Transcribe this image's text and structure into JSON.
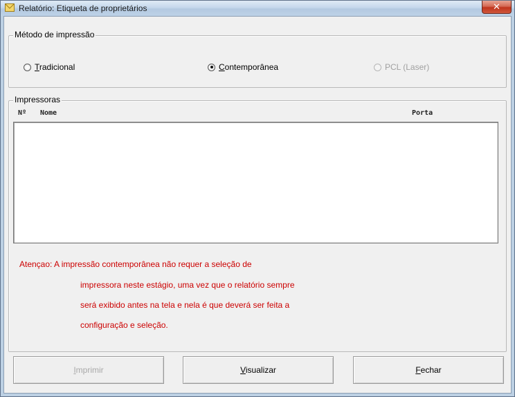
{
  "window": {
    "title": "Relatório: Etiqueta de proprietários",
    "close_glyph": "✕",
    "icon": "envelope-icon"
  },
  "print_method": {
    "legend": "Método de impressão",
    "options": [
      {
        "mnemonic": "T",
        "rest": "radicional",
        "selected": false,
        "enabled": true
      },
      {
        "mnemonic": "C",
        "rest": "ontemporânea",
        "selected": true,
        "enabled": true
      },
      {
        "mnemonic": "",
        "rest": "PCL (Laser)",
        "selected": false,
        "enabled": false
      }
    ]
  },
  "printers": {
    "legend": "Impressoras",
    "columns": {
      "number": "Nº",
      "name": "Nome",
      "port": "Porta"
    },
    "rows": []
  },
  "warning": {
    "lines": [
      "Atençao: A impressão contemporânea não requer a seleção de",
      "impressora neste estágio, uma vez que o relatório sempre",
      "será exibido antes na tela e nela é que deverá ser feita a",
      "configuração e seleção."
    ],
    "color": "#cc0000"
  },
  "buttons": {
    "print": {
      "mnemonic": "I",
      "rest": "mprimir",
      "enabled": false
    },
    "preview": {
      "mnemonic": "V",
      "rest": "isualizar",
      "enabled": true
    },
    "close": {
      "mnemonic": "F",
      "rest": "echar",
      "enabled": true
    }
  }
}
